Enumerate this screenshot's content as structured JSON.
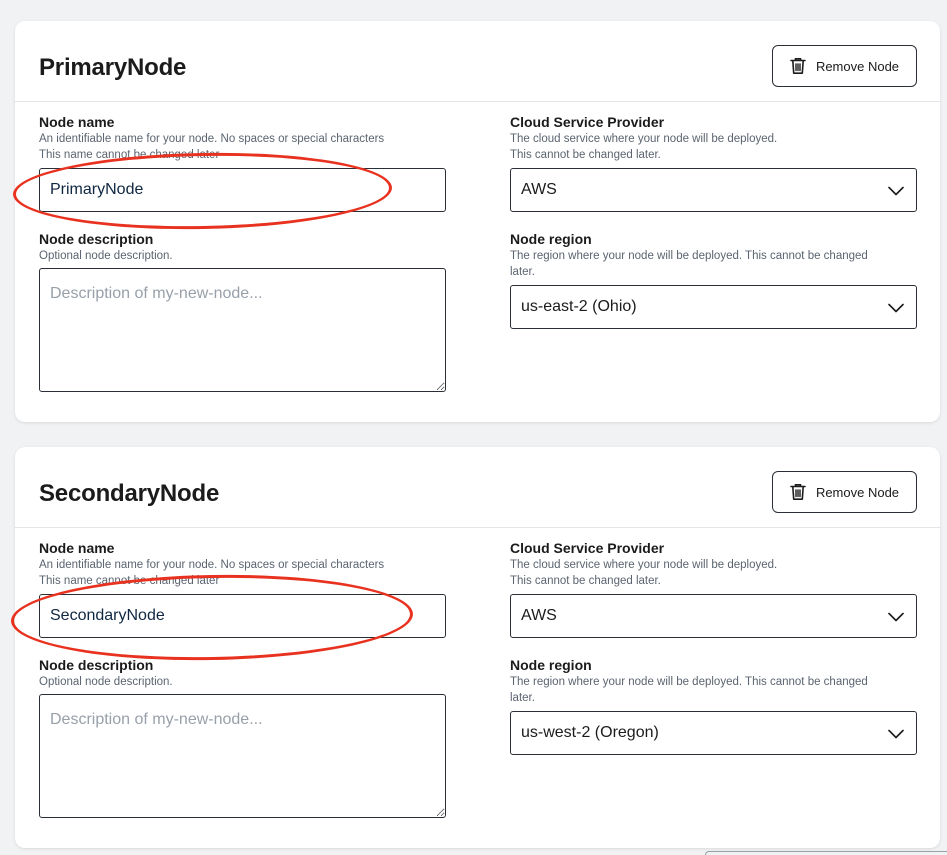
{
  "colors": {
    "page_background": "#f1f2f4",
    "card_background": "#ffffff",
    "annotation_red": "#e8321f",
    "input_border": "#2a2f36",
    "help_text": "#5b6470"
  },
  "icons": {
    "remove": "trash-icon",
    "select_arrow": "chevron-down-icon"
  },
  "nodes": [
    {
      "title": "PrimaryNode",
      "remove_label": "Remove Node",
      "name": {
        "label": "Node name",
        "help_1": "An identifiable name for your node. No spaces or special characters",
        "help_2": "This name cannot be changed later",
        "value": "PrimaryNode"
      },
      "description": {
        "label": "Node description",
        "help": "Optional node description.",
        "placeholder": "Description of my-new-node...",
        "value": ""
      },
      "provider": {
        "label": "Cloud Service Provider",
        "help_1": "The cloud service where your node will be deployed.",
        "help_2": "This cannot be changed later.",
        "value": "AWS"
      },
      "region": {
        "label": "Node region",
        "help_1": "The region where your node will be deployed. This cannot be changed",
        "help_2": "later.",
        "value": "us-east-2 (Ohio)"
      }
    },
    {
      "title": "SecondaryNode",
      "remove_label": "Remove Node",
      "name": {
        "label": "Node name",
        "help_1": "An identifiable name for your node. No spaces or special characters",
        "help_2": "This name cannot be changed later",
        "value": "SecondaryNode"
      },
      "description": {
        "label": "Node description",
        "help": "Optional node description.",
        "placeholder": "Description of my-new-node...",
        "value": ""
      },
      "provider": {
        "label": "Cloud Service Provider",
        "help_1": "The cloud service where your node will be deployed.",
        "help_2": "This cannot be changed later.",
        "value": "AWS"
      },
      "region": {
        "label": "Node region",
        "help_1": "The region where your node will be deployed. This cannot be changed",
        "help_2": "later.",
        "value": "us-west-2 (Oregon)"
      }
    }
  ]
}
